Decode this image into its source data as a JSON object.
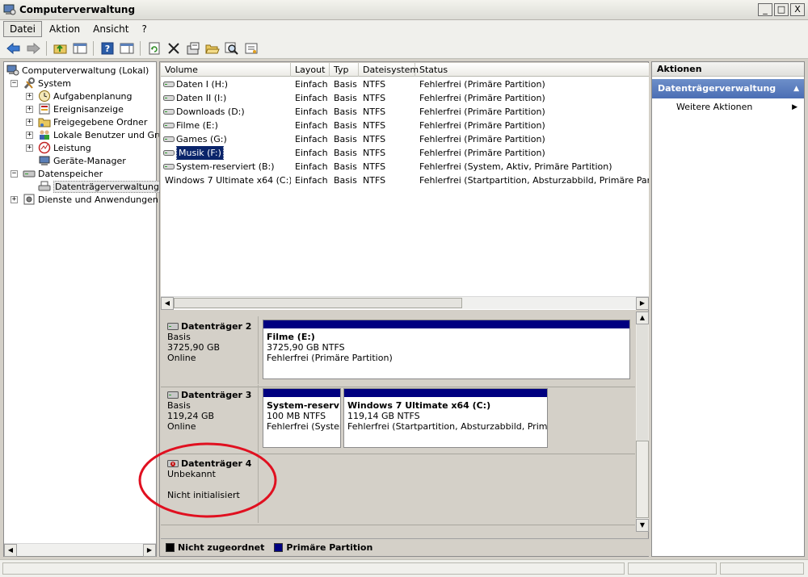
{
  "window": {
    "title": "Computerverwaltung",
    "minimize": "_",
    "maximize": "□",
    "close": "X"
  },
  "menu": [
    "Datei",
    "Aktion",
    "Ansicht",
    "?"
  ],
  "tree": {
    "root": "Computerverwaltung (Lokal)",
    "system": "System",
    "aufgabenplanung": "Aufgabenplanung",
    "ereignisanzeige": "Ereignisanzeige",
    "freigegebene": "Freigegebene Ordner",
    "lokale": "Lokale Benutzer und Grupp",
    "leistung": "Leistung",
    "geraete": "Geräte-Manager",
    "datenspeicher": "Datenspeicher",
    "datentraeger": "Datenträgerverwaltung",
    "dienste": "Dienste und Anwendungen"
  },
  "volumes": {
    "columns": [
      "Volume",
      "Layout",
      "Typ",
      "Dateisystem",
      "Status"
    ],
    "rows": [
      {
        "name": "Daten I (H:)",
        "layout": "Einfach",
        "typ": "Basis",
        "fs": "NTFS",
        "status": "Fehlerfrei (Primäre Partition)"
      },
      {
        "name": "Daten II (I:)",
        "layout": "Einfach",
        "typ": "Basis",
        "fs": "NTFS",
        "status": "Fehlerfrei (Primäre Partition)"
      },
      {
        "name": "Downloads (D:)",
        "layout": "Einfach",
        "typ": "Basis",
        "fs": "NTFS",
        "status": "Fehlerfrei (Primäre Partition)"
      },
      {
        "name": "Filme (E:)",
        "layout": "Einfach",
        "typ": "Basis",
        "fs": "NTFS",
        "status": "Fehlerfrei (Primäre Partition)"
      },
      {
        "name": "Games (G:)",
        "layout": "Einfach",
        "typ": "Basis",
        "fs": "NTFS",
        "status": "Fehlerfrei (Primäre Partition)"
      },
      {
        "name": "Musik (F:)",
        "layout": "Einfach",
        "typ": "Basis",
        "fs": "NTFS",
        "status": "Fehlerfrei (Primäre Partition)"
      },
      {
        "name": "System-reserviert (B:)",
        "layout": "Einfach",
        "typ": "Basis",
        "fs": "NTFS",
        "status": "Fehlerfrei (System, Aktiv, Primäre Partition)"
      },
      {
        "name": "Windows 7 Ultimate x64 (C:)",
        "layout": "Einfach",
        "typ": "Basis",
        "fs": "NTFS",
        "status": "Fehlerfrei (Startpartition, Absturzabbild, Primäre Partition)"
      }
    ]
  },
  "disks": {
    "d2": {
      "name": "Datenträger 2",
      "type": "Basis",
      "size": "3725,90 GB",
      "state": "Online",
      "p1": {
        "name": "Filme  (E:)",
        "size": "3725,90 GB NTFS",
        "status": "Fehlerfrei (Primäre Partition)"
      }
    },
    "d3": {
      "name": "Datenträger 3",
      "type": "Basis",
      "size": "119,24 GB",
      "state": "Online",
      "p1": {
        "name": "System-reserv",
        "size": "100 MB NTFS",
        "status": "Fehlerfrei (Systen"
      },
      "p2": {
        "name": "Windows 7 Ultimate x64  (C:)",
        "size": "119,14 GB NTFS",
        "status": "Fehlerfrei (Startpartition, Absturzabbild, Primäre P"
      }
    },
    "d4": {
      "name": "Datenträger 4",
      "type": "Unbekannt",
      "state": "Nicht initialisiert"
    }
  },
  "legend": {
    "unallocated": "Nicht zugeordnet",
    "primary": "Primäre Partition"
  },
  "actions": {
    "header": "Aktionen",
    "section": "Datenträgerverwaltung",
    "more": "Weitere Aktionen"
  },
  "colors": {
    "primary_partition": "#000080",
    "unallocated": "#000000",
    "annotation": "#e01020",
    "action_section": "#4b6eb4"
  }
}
